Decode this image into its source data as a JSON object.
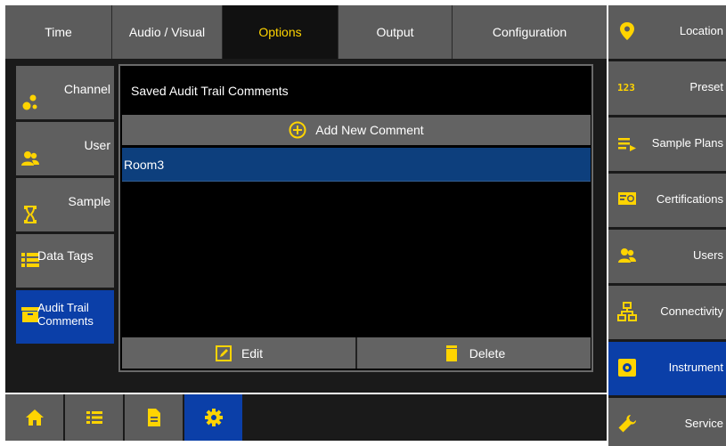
{
  "top_tabs": [
    {
      "label": "Time",
      "active": false
    },
    {
      "label": "Audio / Visual",
      "active": false
    },
    {
      "label": "Options",
      "active": true
    },
    {
      "label": "Output",
      "active": false
    },
    {
      "label": "Configuration",
      "active": false
    }
  ],
  "options_nav": [
    {
      "label": "Channel",
      "icon": "channel-icon",
      "active": false
    },
    {
      "label": "User",
      "icon": "user-icon",
      "active": false
    },
    {
      "label": "Sample",
      "icon": "hourglass-icon",
      "active": false
    },
    {
      "label": "Data Tags",
      "icon": "list-icon",
      "active": false
    },
    {
      "label": "Audit Trail Comments",
      "icon": "comments-box-icon",
      "active": true
    }
  ],
  "panel": {
    "title": "Saved Audit Trail Comments",
    "add_label": "Add New Comment",
    "comments": [
      "Room3"
    ],
    "edit_label": "Edit",
    "delete_label": "Delete"
  },
  "bottom_nav": [
    {
      "icon": "home-icon",
      "active": false
    },
    {
      "icon": "list-icon",
      "active": false
    },
    {
      "icon": "document-icon",
      "active": false
    },
    {
      "icon": "gear-icon",
      "active": true
    }
  ],
  "right_sidebar": [
    {
      "label": "Location",
      "icon": "location-pin-icon",
      "active": false
    },
    {
      "label": "Preset",
      "icon": "numbers-icon",
      "icon_text": "123",
      "active": false
    },
    {
      "label": "Sample Plans",
      "icon": "plan-list-icon",
      "active": false
    },
    {
      "label": "Certifications",
      "icon": "certificate-icon",
      "active": false
    },
    {
      "label": "Users",
      "icon": "users-icon",
      "active": false
    },
    {
      "label": "Connectivity",
      "icon": "network-icon",
      "active": false
    },
    {
      "label": "Instrument",
      "icon": "instrument-icon",
      "active": true
    },
    {
      "label": "Service",
      "icon": "wrench-icon",
      "active": false
    }
  ],
  "colors": {
    "accent": "#ffd400",
    "active_blue": "#0b3fa8",
    "button_gray": "#5c5c5c",
    "selected_row": "#0d3f7d"
  }
}
